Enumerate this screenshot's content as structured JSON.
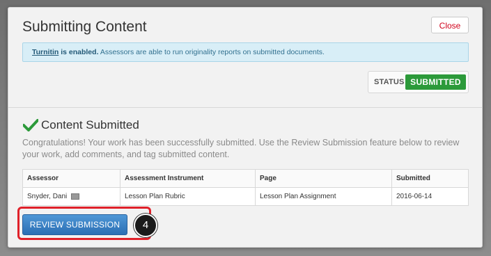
{
  "dialog": {
    "title": "Submitting Content",
    "close_label": "Close"
  },
  "notice": {
    "link_text": "Turnitin",
    "strong_text": " is enabled.",
    "message": " Assessors are able to run originality reports on submitted documents."
  },
  "status": {
    "label": "STATUS",
    "value": "SUBMITTED",
    "color": "#2c9a3a"
  },
  "submission": {
    "heading": "Content Submitted",
    "message": "Congratulations! Your work has been successfully submitted. Use the Review Submission feature below to review your work, add comments, and tag submitted content."
  },
  "table": {
    "headers": [
      "Assessor",
      "Assessment Instrument",
      "Page",
      "Submitted"
    ],
    "rows": [
      {
        "assessor": "Snyder, Dani",
        "instrument": "Lesson Plan Rubric",
        "page": "Lesson Plan Assignment",
        "submitted": "2016-06-14"
      }
    ]
  },
  "actions": {
    "review_label": "REVIEW SUBMISSION",
    "step_number": "4"
  },
  "icons": {
    "check": "check-icon",
    "mail": "mail-icon"
  },
  "colors": {
    "accent_blue": "#2b6fb4",
    "highlight_red": "#e0212a",
    "close_text": "#d0021b"
  }
}
